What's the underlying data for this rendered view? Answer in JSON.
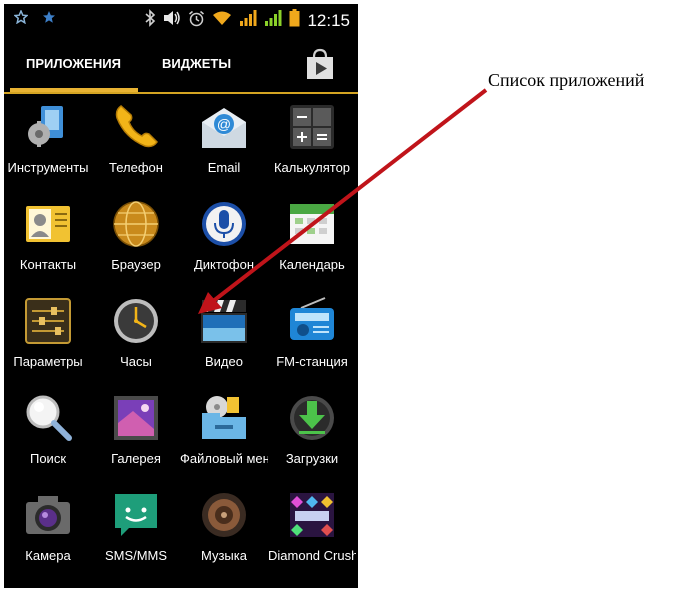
{
  "status_bar": {
    "time": "12:15",
    "icons": [
      "star-icon",
      "star-icon",
      "bluetooth-icon",
      "volume-icon",
      "alarm-icon",
      "wifi-icon",
      "signal-icon",
      "signal-icon",
      "battery-icon"
    ]
  },
  "tabs": {
    "apps": "ПРИЛОЖЕНИЯ",
    "widgets": "ВИДЖЕТЫ",
    "store_icon": "play-store-icon"
  },
  "apps": [
    {
      "label": "Инструменты",
      "icon": "tools-icon"
    },
    {
      "label": "Телефон",
      "icon": "phone-icon"
    },
    {
      "label": "Email",
      "icon": "email-icon"
    },
    {
      "label": "Калькулятор",
      "icon": "calculator-icon"
    },
    {
      "label": "Контакты",
      "icon": "contacts-icon"
    },
    {
      "label": "Браузер",
      "icon": "browser-icon"
    },
    {
      "label": "Диктофон",
      "icon": "microphone-icon"
    },
    {
      "label": "Календарь",
      "icon": "calendar-icon"
    },
    {
      "label": "Параметры",
      "icon": "settings-icon"
    },
    {
      "label": "Часы",
      "icon": "clock-icon"
    },
    {
      "label": "Видео",
      "icon": "video-icon"
    },
    {
      "label": "FM-станция",
      "icon": "radio-icon"
    },
    {
      "label": "Поиск",
      "icon": "search-icon"
    },
    {
      "label": "Галерея",
      "icon": "gallery-icon"
    },
    {
      "label": "Файловый менеджер",
      "icon": "file-manager-icon"
    },
    {
      "label": "Загрузки",
      "icon": "downloads-icon"
    },
    {
      "label": "Камера",
      "icon": "camera-icon"
    },
    {
      "label": "SMS/MMS",
      "icon": "messaging-icon"
    },
    {
      "label": "Музыка",
      "icon": "music-icon"
    },
    {
      "label": "Diamond Crush",
      "icon": "diamond-crush-icon"
    }
  ],
  "annotation": {
    "text": "Список приложений",
    "arrow_color": "#c0141a"
  },
  "colors": {
    "tab_underline": "#e8b333",
    "background": "#000000"
  }
}
